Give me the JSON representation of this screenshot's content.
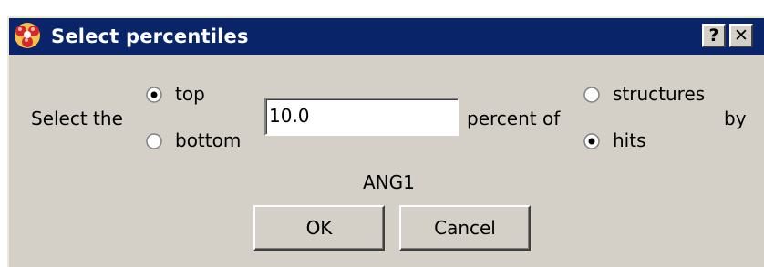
{
  "window": {
    "title": "Select percentiles",
    "help_label": "?",
    "close_label": "✕",
    "titlebar_color": "#0a246a",
    "background_color": "#d4d0c8"
  },
  "form": {
    "prefix_label": "Select the",
    "position_options": [
      {
        "label": "top",
        "selected": true
      },
      {
        "label": "bottom",
        "selected": false
      }
    ],
    "percent_value": "10.0",
    "middle_label": "percent of",
    "basis_options": [
      {
        "label": "structures",
        "selected": false
      },
      {
        "label": "hits",
        "selected": true
      }
    ],
    "suffix_label": "by",
    "target_name": "ANG1"
  },
  "buttons": {
    "ok_label": "OK",
    "cancel_label": "Cancel"
  }
}
